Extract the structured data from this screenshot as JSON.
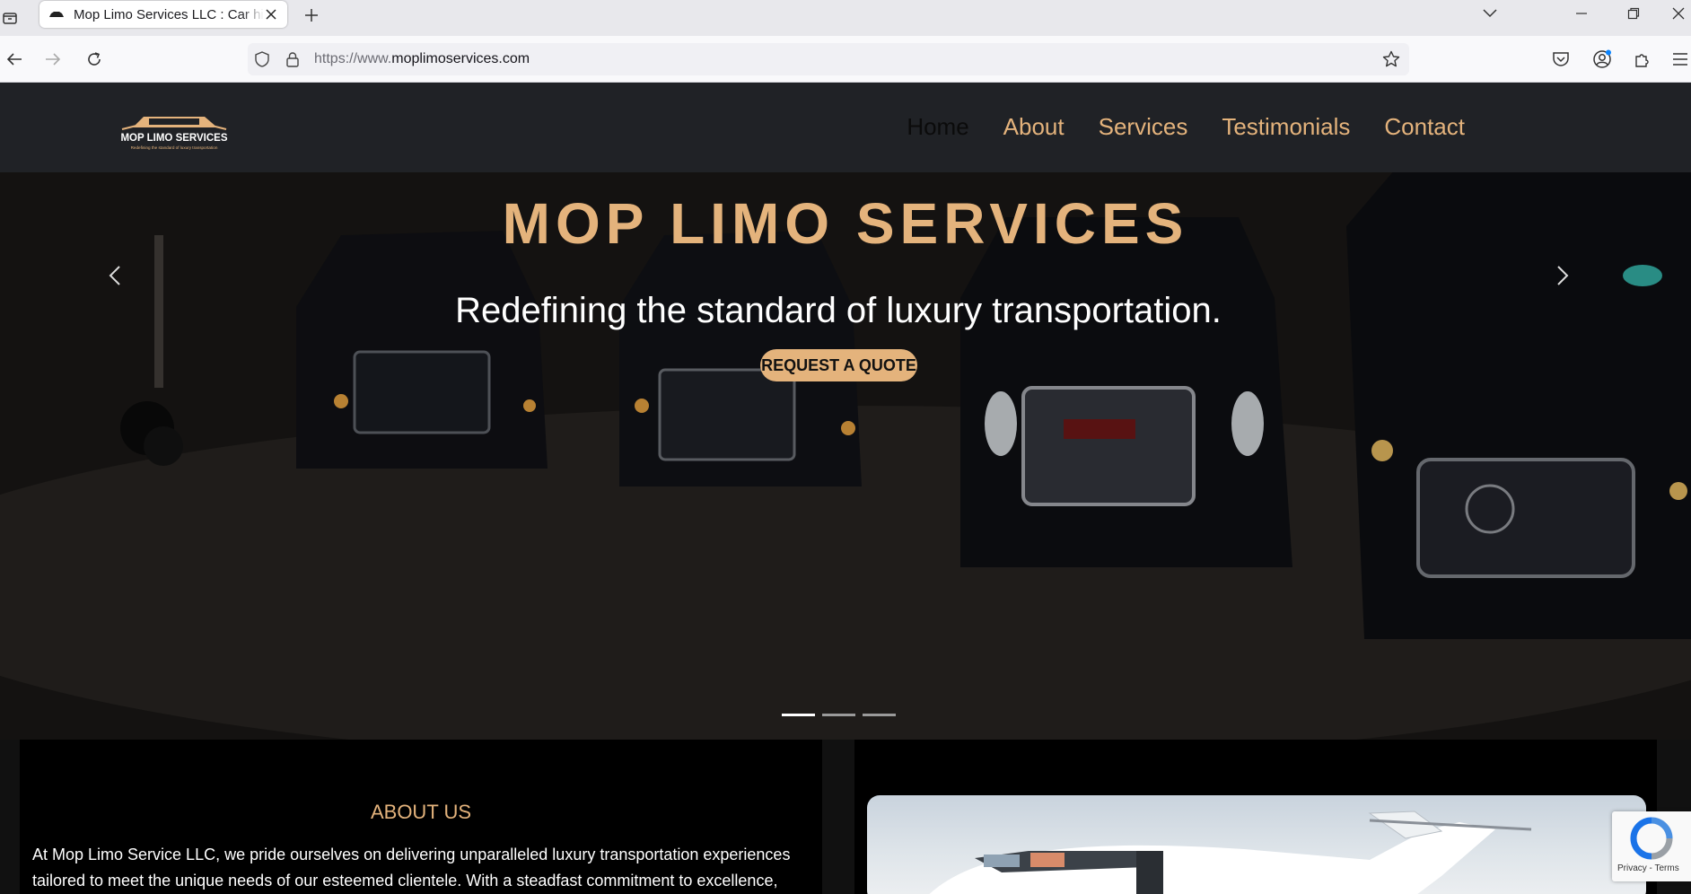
{
  "browser": {
    "tab_title": "Mop Limo Services LLC : Car hire",
    "url_scheme_host_prefix": "https://www.",
    "url_domain": "moplimoservices.com"
  },
  "site": {
    "nav": [
      {
        "label": "Home",
        "active": true
      },
      {
        "label": "About",
        "active": false
      },
      {
        "label": "Services",
        "active": false
      },
      {
        "label": "Testimonials",
        "active": false
      },
      {
        "label": "Contact",
        "active": false
      }
    ],
    "logo_text": "MOP LIMO SERVICES",
    "logo_tagline": "Redefining the standard of luxury transportation",
    "hero": {
      "heading": "MOP LIMO SERVICES",
      "subheading": "Redefining the standard of luxury transportation.",
      "cta": "REQUEST A QUOTE",
      "slide_count": 3,
      "active_slide": 1
    },
    "about": {
      "title": "ABOUT US",
      "text": "At Mop Limo Service LLC, we pride ourselves on delivering unparalleled luxury transportation experiences tailored to meet the unique needs of our esteemed clientele. With a steadfast commitment to excellence,"
    },
    "recaptcha_links": "Privacy - Terms"
  },
  "colors": {
    "accent_gold": "#e4b37c",
    "header_bg": "#202226",
    "browser_tabstrip": "#e8e8ec"
  }
}
